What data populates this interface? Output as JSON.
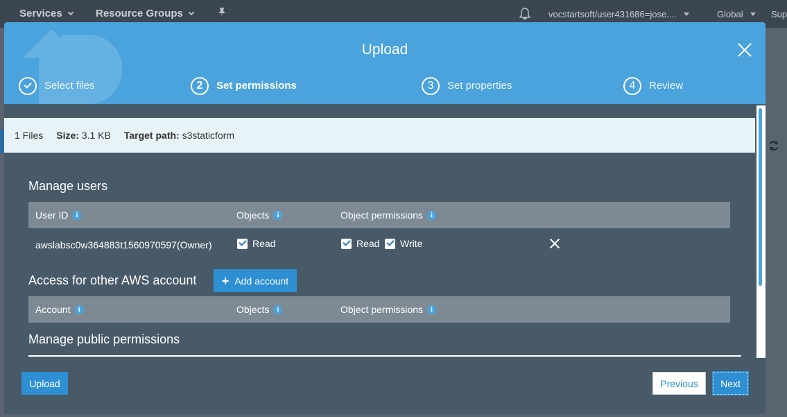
{
  "topbar": {
    "services": "Services",
    "resource_groups": "Resource Groups",
    "account": "vocstartsoft/user431686=jose....",
    "region": "Global",
    "support": "Sup"
  },
  "modal": {
    "title": "Upload",
    "steps": [
      {
        "num": "",
        "label": "Select files",
        "state": "done"
      },
      {
        "num": "2",
        "label": "Set permissions",
        "state": "active"
      },
      {
        "num": "3",
        "label": "Set properties",
        "state": "pending"
      },
      {
        "num": "4",
        "label": "Review",
        "state": "pending"
      }
    ],
    "info": {
      "files": "1 Files",
      "size_label": "Size:",
      "size_value": "3.1 KB",
      "target_label": "Target path:",
      "target_value": "s3staticform"
    },
    "manage_users": {
      "title": "Manage users",
      "headers": {
        "user_id": "User ID",
        "objects": "Objects",
        "object_permissions": "Object permissions"
      },
      "rows": [
        {
          "user": "awslabsc0w364883t1560970597(Owner)",
          "objects_read": "Read",
          "perm_read": "Read",
          "perm_write": "Write"
        }
      ]
    },
    "other_accounts": {
      "title": "Access for other AWS account",
      "add_button": "Add account",
      "headers": {
        "account": "Account",
        "objects": "Objects",
        "object_permissions": "Object permissions"
      }
    },
    "public": {
      "title": "Manage public permissions"
    },
    "footer": {
      "upload": "Upload",
      "previous": "Previous",
      "next": "Next"
    }
  },
  "colors": {
    "header_blue": "#4aa3dc",
    "button_blue": "#2e8fd3",
    "panel_dark": "#485a68"
  }
}
